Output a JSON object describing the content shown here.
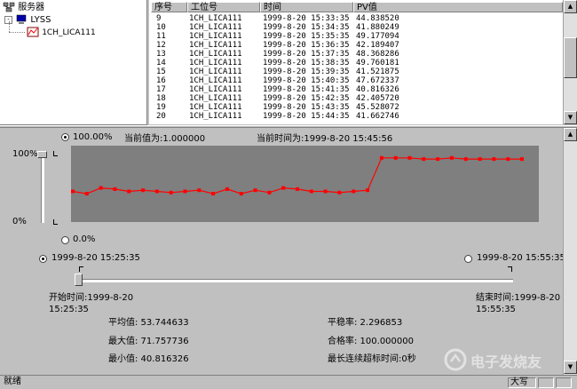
{
  "tree": {
    "root_label": "服务器",
    "node_label": "LYSS",
    "leaf_label": "1CH_LICA111"
  },
  "table": {
    "columns": [
      "序号",
      "工位号",
      "时间",
      "PV值"
    ],
    "rows": [
      [
        "9",
        "1CH_LICA111",
        "1999-8-20 15:33:35",
        "44.838520"
      ],
      [
        "10",
        "1CH_LICA111",
        "1999-8-20 15:34:35",
        "41.880249"
      ],
      [
        "11",
        "1CH_LICA111",
        "1999-8-20 15:35:35",
        "49.177094"
      ],
      [
        "12",
        "1CH_LICA111",
        "1999-8-20 15:36:35",
        "42.189407"
      ],
      [
        "13",
        "1CH_LICA111",
        "1999-8-20 15:37:35",
        "48.368286"
      ],
      [
        "14",
        "1CH_LICA111",
        "1999-8-20 15:38:35",
        "49.760181"
      ],
      [
        "15",
        "1CH_LICA111",
        "1999-8-20 15:39:35",
        "41.521875"
      ],
      [
        "16",
        "1CH_LICA111",
        "1999-8-20 15:40:35",
        "47.672337"
      ],
      [
        "17",
        "1CH_LICA111",
        "1999-8-20 15:41:35",
        "40.816326"
      ],
      [
        "18",
        "1CH_LICA111",
        "1999-8-20 15:42:35",
        "42.405720"
      ],
      [
        "19",
        "1CH_LICA111",
        "1999-8-20 15:43:35",
        "45.528072"
      ],
      [
        "20",
        "1CH_LICA111",
        "1999-8-20 15:44:35",
        "41.662746"
      ]
    ]
  },
  "trend": {
    "top_radio_label": "100.00%",
    "bottom_radio_label": "0.0%",
    "current_value": "当前值为:1.000000",
    "current_time": "当前时间为:1999-8-20 15:45:56",
    "y_top": "100%",
    "y_bottom": "0%",
    "line_color": "#ff0000",
    "plot_bg": "#7f7f7f"
  },
  "chart_data": {
    "type": "line",
    "series": [
      {
        "values": [
          45,
          43,
          48,
          47,
          45,
          46,
          45,
          44,
          45,
          46,
          43,
          47,
          43,
          46,
          44,
          48,
          47,
          45,
          45,
          44,
          45,
          46,
          74,
          74,
          74,
          73,
          73,
          74,
          73,
          73,
          73,
          73,
          73
        ]
      }
    ],
    "ylim": [
      0,
      100
    ]
  },
  "range": {
    "start_radio": "1999-8-20 15:25:35",
    "end_radio": "1999-8-20 15:55:35",
    "start_label": "开始时间:1999-8-20",
    "start_label2": "15:25:35",
    "end_label": "结束时间:1999-8-20",
    "end_label2": "15:55:35"
  },
  "stats": {
    "avg": "平均值:  53.744633",
    "max": "最大值:  71.757736",
    "min": "最小值:  40.816326",
    "stability": "平稳率:  2.296853",
    "pass_rate": "合格率:  100.000000",
    "longest": "最长连续超标时间:0秒"
  },
  "status": {
    "ready": "就绪",
    "caps": "大写"
  },
  "watermark": "电子发烧友"
}
